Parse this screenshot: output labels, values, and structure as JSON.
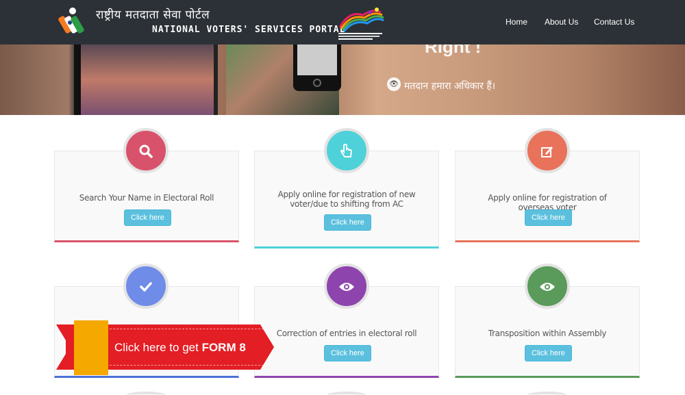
{
  "header": {
    "hindi_title": "राष्ट्रीय मतदाता सेवा पोर्टल",
    "english_title": "NATIONAL VOTERS' SERVICES PORTAL",
    "nav": [
      {
        "label": "Home"
      },
      {
        "label": "About Us"
      },
      {
        "label": "Contact Us"
      }
    ]
  },
  "banner": {
    "partial_text": "Right !",
    "slogan": "मतदान हमारा अधिकार हैं।"
  },
  "cards": [
    {
      "icon": "search-icon",
      "text": "Search Your Name in Electoral Roll",
      "button": "Click here",
      "color": "#d9526b"
    },
    {
      "icon": "hand-pointer-icon",
      "text": "Apply online for registration of new voter/due to shifting from AC",
      "button": "Click here",
      "color": "#4fd1d9"
    },
    {
      "icon": "edit-icon",
      "text": "Apply online for registration of overseas voter",
      "button": "Click here",
      "color": "#e8735a"
    },
    {
      "icon": "check-icon",
      "text": "",
      "button": "",
      "color": "#6f8de8"
    },
    {
      "icon": "eye-icon",
      "text": "Correction of entries in electoral roll",
      "button": "Click here",
      "color": "#8e44ad"
    },
    {
      "icon": "eye-icon",
      "text": "Transposition within Assembly",
      "button": "Click here",
      "color": "#5a9a5a"
    }
  ],
  "ribbon": {
    "text_prefix": "Click here to get ",
    "text_bold": "FORM 8"
  },
  "colors": {
    "header_bg": "#2c3137",
    "button": "#5bc0de",
    "ribbon_red": "#e31e24",
    "ribbon_yellow": "#f5a800"
  }
}
